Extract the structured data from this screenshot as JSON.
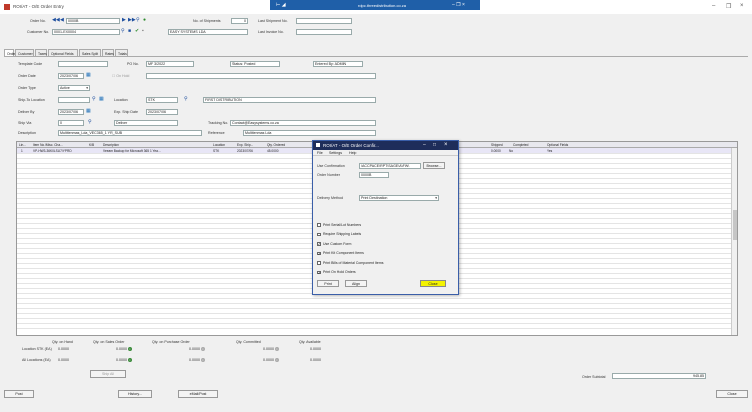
{
  "window": {
    "title": "ROI/AT - O/E Order Entry"
  },
  "rdp": {
    "host": "rdpc.threedistribution.co.za"
  },
  "header": {
    "order_no_label": "Order No.",
    "order_no": "0000B",
    "num_shipments_label": "No. of Shipments",
    "num_shipments": "0",
    "last_shipment_label": "Last Shipment No.",
    "last_shipment": "",
    "customer_no_label": "Customer No.",
    "customer_no": "0001-EX0004",
    "customer_name": "EASY SYSTEMS LDA",
    "last_invoice_label": "Last Invoice No.",
    "last_invoice": ""
  },
  "tabs": [
    "Order",
    "Customer",
    "Taxes",
    "Optional Fields",
    "Sales Split",
    "Rates",
    "Totals"
  ],
  "form": {
    "template_code_label": "Template Code",
    "template_code": "",
    "po_no_label": "PO No.",
    "po_no": "MF 3/2022",
    "status": "Status: Posted",
    "entered_by": "Entered By: ADMIN",
    "order_date_label": "Order Date",
    "order_date": "2023/07/06",
    "on_hold_label": "On Hold",
    "on_hold_reason": "",
    "order_type_label": "Order Type",
    "order_type": "Active",
    "ship_to_label": "Ship-To Location",
    "ship_to": "",
    "location_label": "Location",
    "location": "STK",
    "location_name": "FIRST DISTRIBUTION",
    "deliver_by_label": "Deliver By",
    "deliver_by": "2023/07/06",
    "exp_ship_label": "Exp. Ship Date",
    "exp_ship": "2023/07/06",
    "ship_via_label": "Ship Via",
    "ship_via": "0",
    "ship_via_name": "Deliver",
    "tracking_label": "Tracking No.",
    "tracking": "Contact@Easysystems.co.za",
    "description_label": "Description",
    "description": "Multitenmas_Lda_VEC365_1 YR_SUB",
    "reference_label": "Reference",
    "reference": "Multitenmas Lda"
  },
  "grid": {
    "headers": [
      "Lin...",
      "Item No./Misc. Cha...",
      "K/B",
      "Description",
      "Location",
      "Exp. Ship...",
      "Qty. Ordered",
      "Shipped",
      "Completed",
      "Optional Fields"
    ],
    "rows": [
      {
        "line": "1",
        "item": "VP-HW3-36K0LSU7/YPRD",
        "kb": "",
        "desc": "Veeam Backup for Microsoft 365 1 Yea...",
        "loc": "STK",
        "ship": "2023/07/06",
        "qty": "45.0000",
        "shipped": "0.0000",
        "completed": "No",
        "opt": "Yes"
      }
    ]
  },
  "totals": {
    "col_headers": [
      "Qty. on Hand",
      "Qty. on Sales Order",
      "Qty. on Purchase Order",
      "Qty. Committed",
      "Qty. Available"
    ],
    "loc_label": "Location STK (EA)",
    "loc_values": [
      "0.0000",
      "0.0000",
      "0.0000",
      "0.0000",
      "0.0000"
    ],
    "all_label": "All Locations (EA)",
    "all_values": [
      "0.0000",
      "0.0000",
      "0.0000",
      "0.0000",
      "0.0000"
    ],
    "ship_all": "Ship All",
    "subtotal_label": "Order Subtotal",
    "subtotal": "945.85"
  },
  "footer": {
    "post": "Post",
    "history": "History...",
    "prepost": "eMail/Post",
    "close": "Close"
  },
  "dialog": {
    "title": "ROI/AT - O/E Order Confir...",
    "menu": [
      "File",
      "Settings",
      "Help"
    ],
    "use_confirmation_label": "Use Confirmation",
    "use_confirmation": "\\ACCPACE\\RPT\\SAGE\\A\\FW\\",
    "browse": "Browse...",
    "order_number_label": "Order Number",
    "order_number": "0000B",
    "delivery_method_label": "Delivery Method",
    "delivery_method": "Print Destination",
    "checks": [
      {
        "label": "Print Serial/Lot Numbers",
        "checked": false
      },
      {
        "label": "Require Shipping Labels",
        "checked": false
      },
      {
        "label": "Use Custom Form",
        "checked": true
      },
      {
        "label": "Print Kit Component Items",
        "checked": true
      },
      {
        "label": "Print Bills of Material Component Items",
        "checked": false
      },
      {
        "label": "Print On Hold Orders",
        "checked": true
      }
    ],
    "print": "Print",
    "align": "Align",
    "close": "Close"
  }
}
